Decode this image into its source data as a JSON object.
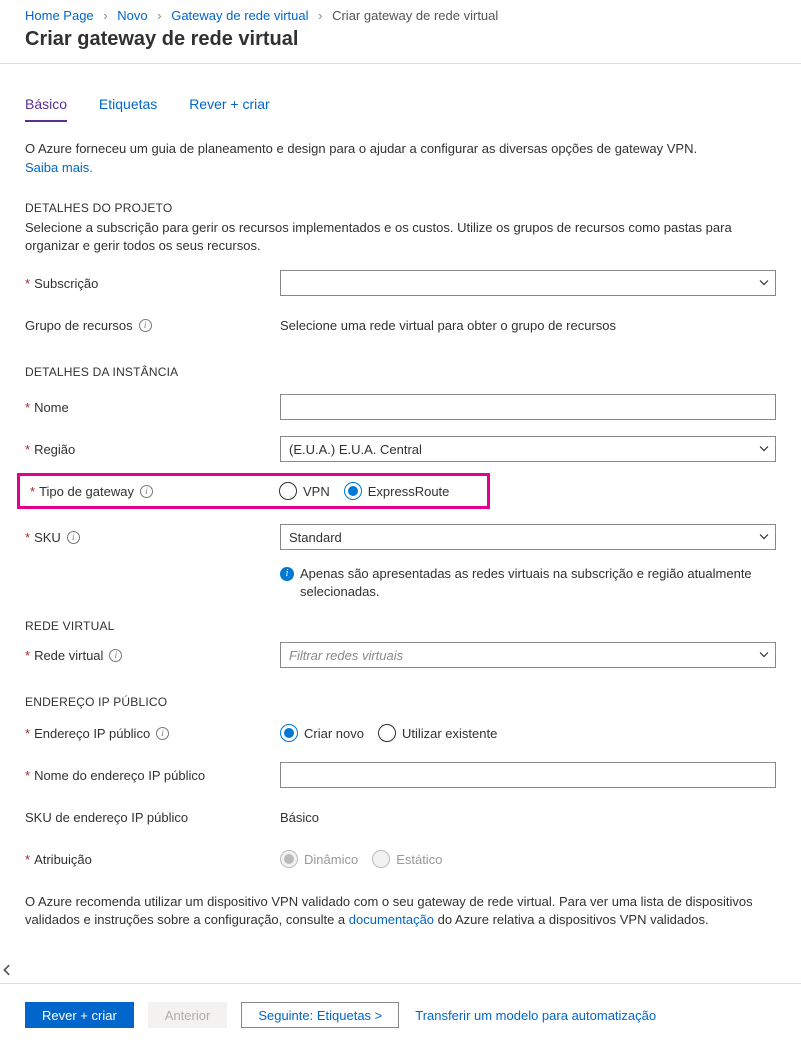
{
  "breadcrumb": {
    "items": [
      "Home Page",
      "Novo",
      "Gateway de rede virtual"
    ],
    "current": "Criar gateway de rede virtual"
  },
  "page_title": "Criar gateway de rede virtual",
  "tabs": {
    "basic": "Básico",
    "tags": "Etiquetas",
    "review": "Rever + criar"
  },
  "intro": {
    "text": "O Azure forneceu um guia de planeamento e design para o ajudar a configurar as diversas opções de gateway VPN.",
    "learn_more": "Saiba mais."
  },
  "sections": {
    "project": {
      "heading": "DETALHES DO PROJETO",
      "desc": "Selecione a subscrição para gerir os recursos implementados e os custos. Utilize os grupos de recursos como pastas para organizar e gerir todos os seus recursos.",
      "subscription_label": "Subscrição",
      "resource_group_label": "Grupo de recursos",
      "resource_group_text": "Selecione uma rede virtual para obter o grupo de recursos"
    },
    "instance": {
      "heading": "DETALHES DA INSTÂNCIA",
      "name_label": "Nome",
      "region_label": "Região",
      "region_value": "(E.U.A.) E.U.A. Central",
      "gateway_type_label": "Tipo de gateway",
      "gateway_type_options": {
        "vpn": "VPN",
        "expressroute": "ExpressRoute"
      },
      "sku_label": "SKU",
      "sku_value": "Standard",
      "vnet_note": "Apenas são apresentadas as redes virtuais na subscrição e região atualmente selecionadas."
    },
    "vnet": {
      "heading": "REDE VIRTUAL",
      "label": "Rede virtual",
      "placeholder": "Filtrar redes virtuais"
    },
    "public_ip": {
      "heading": "ENDEREÇO IP PÚBLICO",
      "address_label": "Endereço IP público",
      "options": {
        "create": "Criar novo",
        "use": "Utilizar existente"
      },
      "name_label": "Nome do endereço IP público",
      "sku_label": "SKU de endereço IP público",
      "sku_value": "Básico",
      "assignment_label": "Atribuição",
      "assignment_options": {
        "dynamic": "Dinâmico",
        "static": "Estático"
      }
    }
  },
  "bottom_note": {
    "before": "O Azure recomenda utilizar um dispositivo VPN validado com o seu gateway de rede virtual. Para ver uma lista de dispositivos validados e instruções sobre a configuração, consulte a ",
    "link": "documentação",
    "after": " do Azure relativa a dispositivos VPN validados."
  },
  "footer": {
    "review": "Rever + criar",
    "prev": "Anterior",
    "next": "Seguinte: Etiquetas >",
    "download": "Transferir um modelo para automatização"
  }
}
